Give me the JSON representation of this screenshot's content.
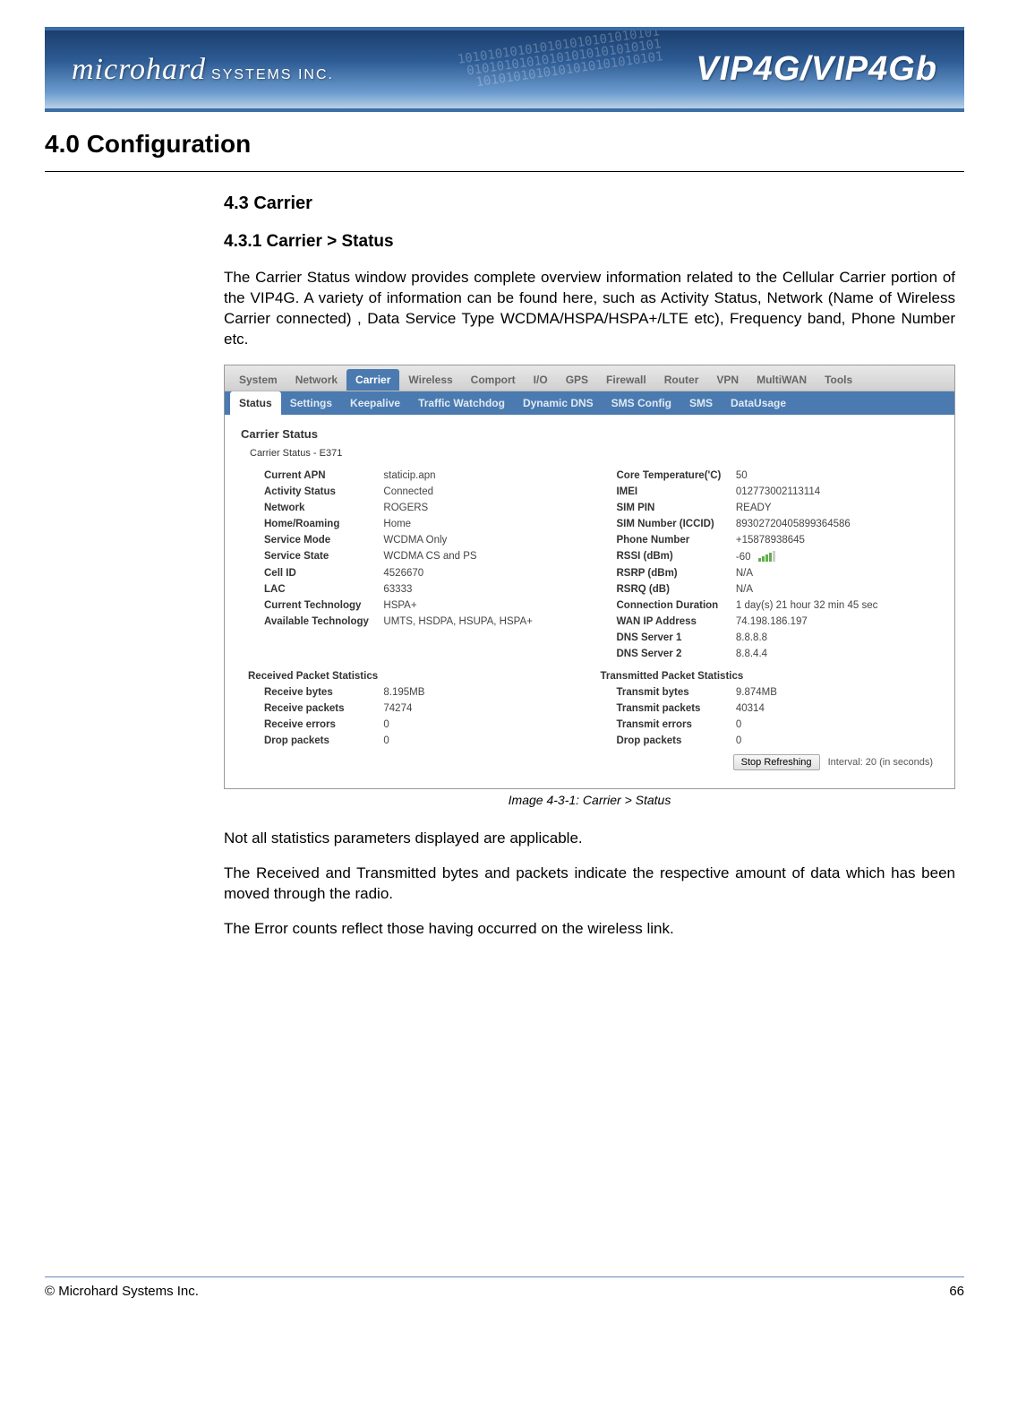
{
  "banner": {
    "brand": "microhard",
    "brand_sub": "SYSTEMS INC.",
    "product": "VIP4G/VIP4Gb"
  },
  "chapter_title": "4.0  Configuration",
  "section_title": "4.3 Carrier",
  "subsection_title": "4.3.1 Carrier > Status",
  "intro_para": "The Carrier Status window provides complete overview information related to the Cellular Carrier portion of the VIP4G. A variety of information can be found here, such as Activity Status, Network (Name of Wireless Carrier connected) , Data Service Type WCDMA/HSPA/HSPA+/LTE etc), Frequency band, Phone Number etc.",
  "tabs_main": [
    "System",
    "Network",
    "Carrier",
    "Wireless",
    "Comport",
    "I/O",
    "GPS",
    "Firewall",
    "Router",
    "VPN",
    "MultiWAN",
    "Tools"
  ],
  "tabs_main_active": 2,
  "tabs_sub": [
    "Status",
    "Settings",
    "Keepalive",
    "Traffic Watchdog",
    "Dynamic DNS",
    "SMS Config",
    "SMS",
    "DataUsage"
  ],
  "tabs_sub_active": 0,
  "panel_title": "Carrier Status",
  "panel_subtitle": "Carrier Status - E371",
  "rows_left": [
    {
      "label": "Current APN",
      "value": "staticip.apn"
    },
    {
      "label": "Activity Status",
      "value": "Connected"
    },
    {
      "label": "Network",
      "value": "ROGERS"
    },
    {
      "label": "Home/Roaming",
      "value": "Home"
    },
    {
      "label": "Service Mode",
      "value": "WCDMA Only"
    },
    {
      "label": "Service State",
      "value": "WCDMA CS and PS"
    },
    {
      "label": "Cell ID",
      "value": "4526670"
    },
    {
      "label": "LAC",
      "value": "63333"
    },
    {
      "label": "Current Technology",
      "value": "HSPA+"
    },
    {
      "label": "Available Technology",
      "value": "UMTS, HSDPA, HSUPA, HSPA+"
    }
  ],
  "rows_right": [
    {
      "label": "Core Temperature('C)",
      "value": "50"
    },
    {
      "label": "IMEI",
      "value": "012773002113114"
    },
    {
      "label": "SIM PIN",
      "value": "READY"
    },
    {
      "label": "SIM Number (ICCID)",
      "value": "89302720405899364586"
    },
    {
      "label": "Phone Number",
      "value": "+15878938645"
    },
    {
      "label": "RSSI (dBm)",
      "value": "-60"
    },
    {
      "label": "RSRP (dBm)",
      "value": "N/A"
    },
    {
      "label": "RSRQ (dB)",
      "value": "N/A"
    },
    {
      "label": "Connection Duration",
      "value": "1 day(s) 21 hour 32 min 45 sec"
    },
    {
      "label": "WAN IP Address",
      "value": "74.198.186.197"
    },
    {
      "label": "DNS Server 1",
      "value": "8.8.8.8"
    },
    {
      "label": "DNS Server 2",
      "value": "8.8.4.4"
    }
  ],
  "rx_header": "Received Packet Statistics",
  "tx_header": "Transmitted Packet Statistics",
  "rx_rows": [
    {
      "label": "Receive bytes",
      "value": "8.195MB"
    },
    {
      "label": "Receive packets",
      "value": "74274"
    },
    {
      "label": "Receive errors",
      "value": "0"
    },
    {
      "label": "Drop packets",
      "value": "0"
    }
  ],
  "tx_rows": [
    {
      "label": "Transmit bytes",
      "value": "9.874MB"
    },
    {
      "label": "Transmit packets",
      "value": "40314"
    },
    {
      "label": "Transmit errors",
      "value": "0"
    },
    {
      "label": "Drop packets",
      "value": "0"
    }
  ],
  "stop_refresh_label": "Stop Refreshing",
  "interval_text": "Interval: 20 (in seconds)",
  "caption": "Image 4-3-1:  Carrier  > Status",
  "para2": "Not all statistics parameters displayed are applicable.",
  "para3": "The Received and Transmitted bytes and packets indicate the respective amount of data which has been moved through the radio.",
  "para4": "The Error counts reflect those having occurred on the wireless link.",
  "footer_left": "© Microhard Systems Inc.",
  "footer_right": "66"
}
